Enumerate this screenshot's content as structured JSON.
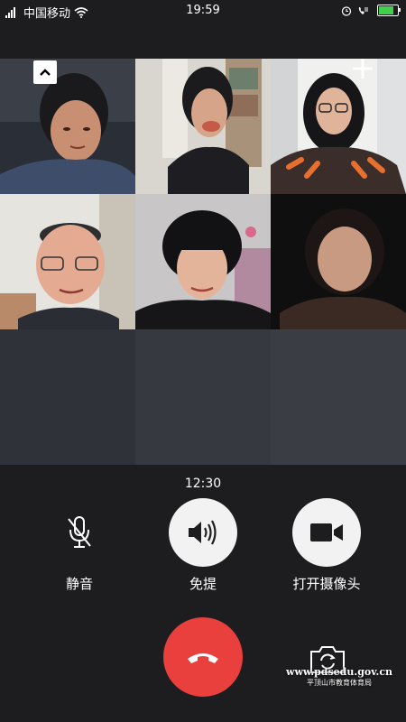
{
  "status_bar": {
    "carrier": "中国移动",
    "time": "19:59"
  },
  "participants": [
    {
      "id": "p1"
    },
    {
      "id": "p2"
    },
    {
      "id": "p3"
    },
    {
      "id": "p4"
    },
    {
      "id": "p5"
    },
    {
      "id": "p6"
    }
  ],
  "call": {
    "duration": "12:30",
    "mute_label": "静音",
    "speaker_label": "免提",
    "camera_label": "打开摄像头"
  },
  "watermark": {
    "url": "www.pdsedu.gov.cn",
    "org": "平顶山市教育体育局"
  },
  "colors": {
    "hangup": "#e9403e",
    "background": "#1d1d1f",
    "battery": "#3fd14a"
  }
}
